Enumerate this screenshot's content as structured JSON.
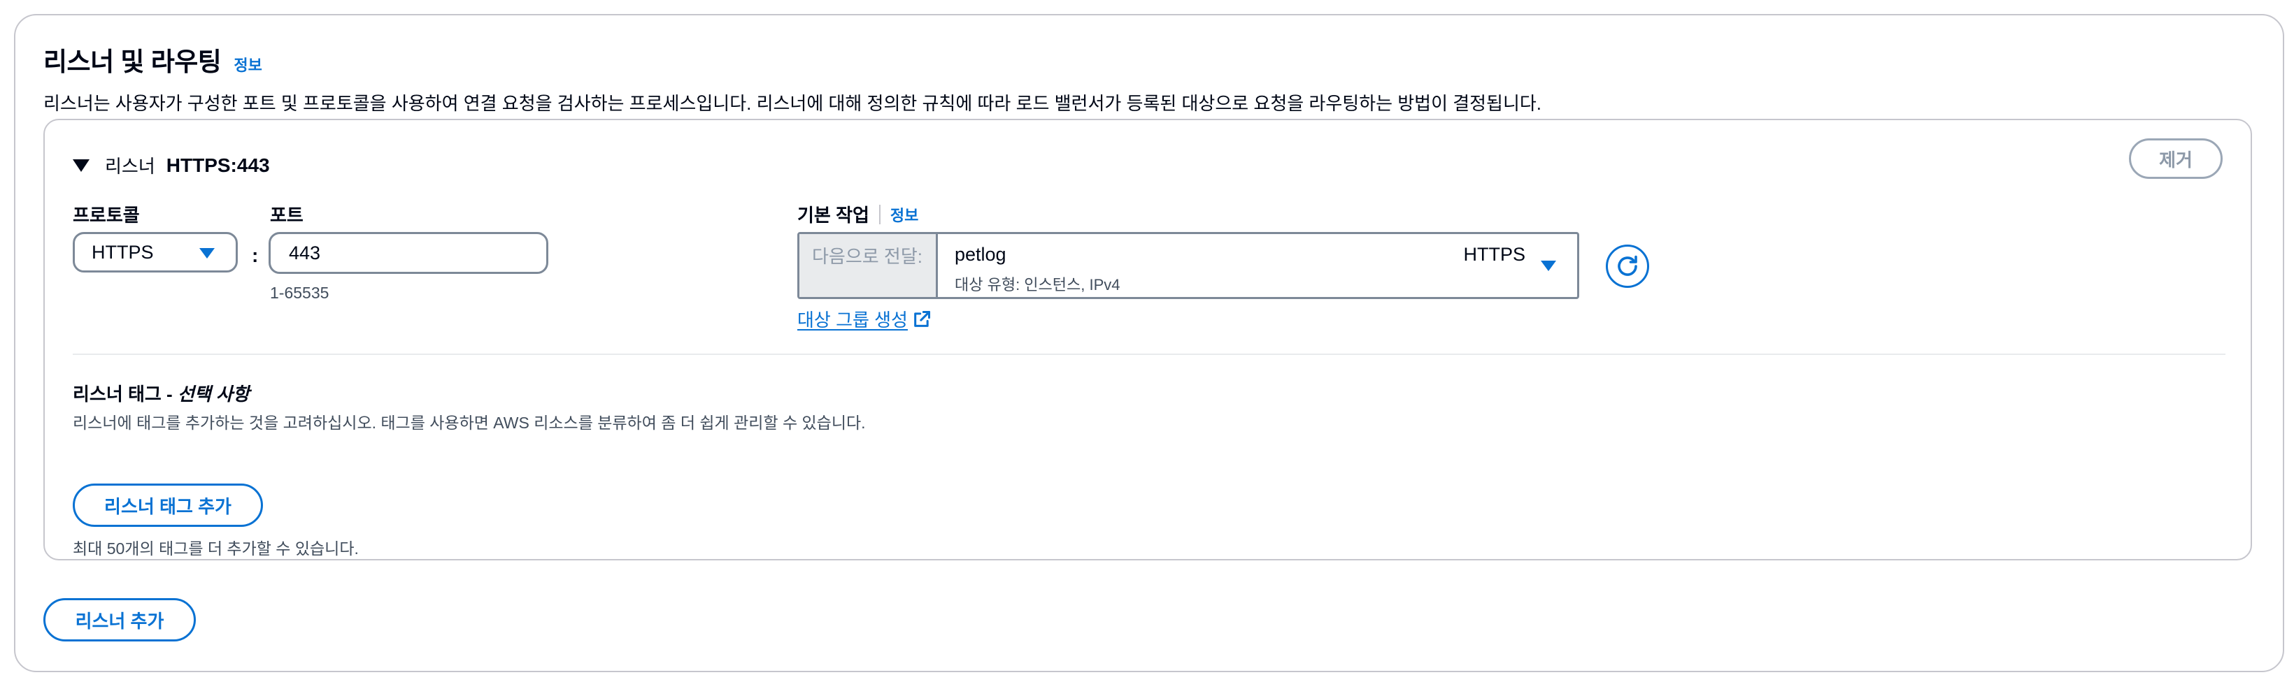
{
  "section": {
    "title": "리스너 및 라우팅",
    "info_label": "정보",
    "description": "리스너는 사용자가 구성한 포트 및 프로토콜을 사용하여 연결 요청을 검사하는 프로세스입니다. 리스너에 대해 정의한 규칙에 따라 로드 밸런서가 등록된 대상으로 요청을 라우팅하는 방법이 결정됩니다."
  },
  "listener": {
    "expander_label": "리스너",
    "expander_value": "HTTPS:443",
    "remove_label": "제거",
    "protocol": {
      "label": "프로토콜",
      "value": "HTTPS"
    },
    "port": {
      "label": "포트",
      "value": "443",
      "hint": "1-65535"
    },
    "default_action": {
      "label": "기본 작업",
      "info_label": "정보",
      "prefix": "다음으로 전달:",
      "target_name": "petlog",
      "target_protocol": "HTTPS",
      "target_subtext": "대상 유형: 인스턴스, IPv4",
      "create_link": "대상 그룹 생성"
    },
    "tags": {
      "title": "리스너 태그 - ",
      "title_optional": "선택 사항",
      "description": "리스너에 태그를 추가하는 것을 고려하십시오. 태그를 사용하면 AWS 리소스를 분류하여 좀 더 쉽게 관리할 수 있습니다.",
      "add_button": "리스너 태그 추가",
      "limit_text": "최대 50개의 태그를 더 추가할 수 있습니다."
    }
  },
  "add_listener_button": "리스너 추가",
  "colors": {
    "accent": "#0972d3",
    "border": "#7d8998",
    "text": "#000716",
    "muted": "#414d5c"
  },
  "icons": [
    "caret-down-icon",
    "dropdown-icon",
    "refresh-icon",
    "external-link-icon"
  ]
}
